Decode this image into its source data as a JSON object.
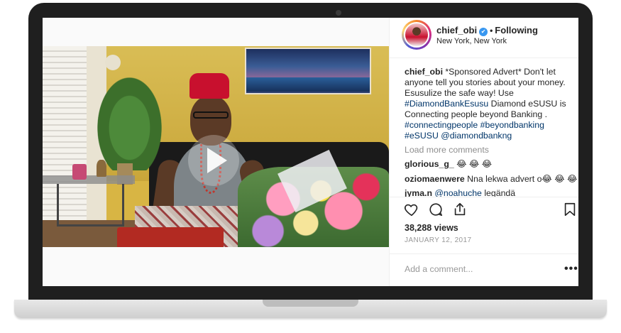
{
  "post": {
    "username": "chief_obi",
    "verified_glyph": "✔",
    "separator": "•",
    "follow_status": "Following",
    "location": "New York, New York",
    "caption": {
      "author": "chief_obi",
      "text_1": " *Sponsored Advert* Don't let anyone tell you stories about your money. Esusulize the safe way! Use ",
      "tag_1": "#DiamondBankEsusu",
      "text_2": " Diamond eSUSU is Connecting people beyond Banking . ",
      "tag_2": "#connectingpeople",
      "text_3": " ",
      "tag_3": "#beyondbanking",
      "text_4": " ",
      "tag_4": "#eSUSU",
      "text_5": " ",
      "tag_5": "@diamondbankng"
    },
    "load_more_label": "Load more comments",
    "comments": [
      {
        "user": "glorious_g_",
        "text": " 😂 😂 😂"
      },
      {
        "user": "oziomaenwere",
        "text": " Nna lekwa advert o😂 😂 😂"
      },
      {
        "user": "jyma.n",
        "mention": "@noahuche",
        "text": " legändä"
      }
    ],
    "views": "38,288 views",
    "date": "JANUARY 12, 2017",
    "comment_placeholder": "Add a comment...",
    "more_options": "•••"
  },
  "icons": {
    "like": "heart-icon",
    "comment": "comment-icon",
    "share": "share-icon",
    "save": "bookmark-icon",
    "play": "play-icon"
  },
  "colors": {
    "hashtag": "#003569",
    "verified": "#3897f0",
    "muted": "#8e8e8e",
    "border": "#efefef"
  }
}
